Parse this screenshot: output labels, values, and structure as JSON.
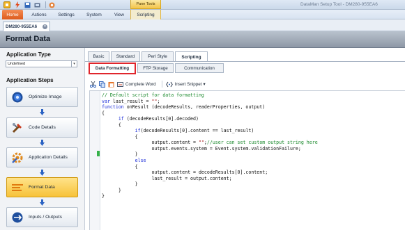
{
  "window": {
    "title": "DataMan Setup Tool - DM280-955EA6",
    "contextual_tab": "Pane Tools"
  },
  "menu": [
    "Home",
    "Actions",
    "Settings",
    "System",
    "View",
    "Scripting"
  ],
  "device_tab": {
    "label": "DM280-955EA6"
  },
  "page_title": "Format Data",
  "sidebar": {
    "app_type_heading": "Application Type",
    "app_type_value": "Undefined",
    "steps_heading": "Application Steps",
    "steps": [
      {
        "label": "Optimize Image",
        "icon": "optimize-image-icon",
        "active": false
      },
      {
        "label": "Code Details",
        "icon": "code-details-icon",
        "active": false
      },
      {
        "label": "Application Details",
        "icon": "application-details-icon",
        "active": false
      },
      {
        "label": "Format Data",
        "icon": "format-data-icon",
        "active": true
      },
      {
        "label": "Inputs / Outputs",
        "icon": "inputs-outputs-icon",
        "active": false
      }
    ]
  },
  "tabs": [
    "Basic",
    "Standard",
    "Perl Style",
    "Scripting"
  ],
  "active_tab": "Scripting",
  "sub_tabs": [
    "Data Formatting",
    "FTP Storage",
    "Communication"
  ],
  "active_sub_tab": "Data Formatting",
  "toolbar": {
    "complete_word": "Complete Word",
    "insert_snippet": "Insert Snippet",
    "insert_snippet_arrow": "▾"
  },
  "code_lines": [
    "// Default script for data formatting",
    "var last_result = \"\";",
    "function onResult (decodeResults, readerProperties, output)",
    "{",
    "      if (decodeResults[0].decoded)",
    "      {",
    "            if(decodeResults[0].content == last_result)",
    "            {",
    "                  output.content = \"\";//user can set custom output string here",
    "                  output.events.system = Event.system.validationFailure;",
    "            }",
    "            else",
    "            {",
    "                  output.content = decodeResults[0].content;",
    "                  last_result = output.content;",
    "            }",
    "      }",
    "}"
  ],
  "colors": {
    "keyword": "#1a2bd8",
    "comment": "#1c8a2e",
    "string": "#a31515",
    "highlight_border": "#e0262c",
    "active_step": "#f7c23a",
    "home_tab": "#dd5b1d"
  }
}
